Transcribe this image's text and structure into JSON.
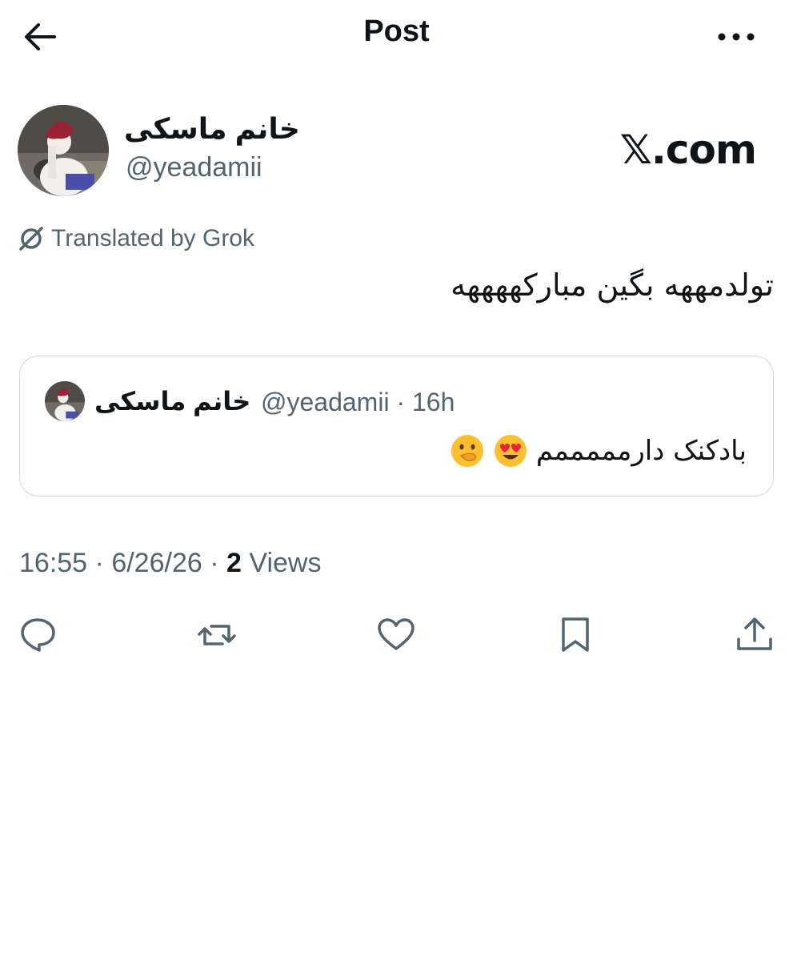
{
  "header": {
    "title": "Post",
    "back_icon": "arrow-left-icon",
    "more_icon": "more-horizontal-icon"
  },
  "author": {
    "name": "خانم ماسکی",
    "handle": "@yeadamii"
  },
  "brand": {
    "mark": "𝕏.com"
  },
  "translation": {
    "label": "Translated by Grok",
    "icon": "grok-icon"
  },
  "post": {
    "text": "تولدمههه بگین مبارکههههه"
  },
  "quote": {
    "name": "خانم ماسکی",
    "meta": "@yeadamii · 16h",
    "text": "بادکنک دارمممممم"
  },
  "stats": {
    "time": "16:55",
    "date": "6/26/26",
    "views_count": "2",
    "views_label": "Views"
  },
  "actions": [
    "reply-icon",
    "repost-icon",
    "like-icon",
    "bookmark-icon",
    "share-icon"
  ],
  "colors": {
    "text": "#0f1419",
    "secondary": "#536471",
    "border": "#cfd9de"
  }
}
